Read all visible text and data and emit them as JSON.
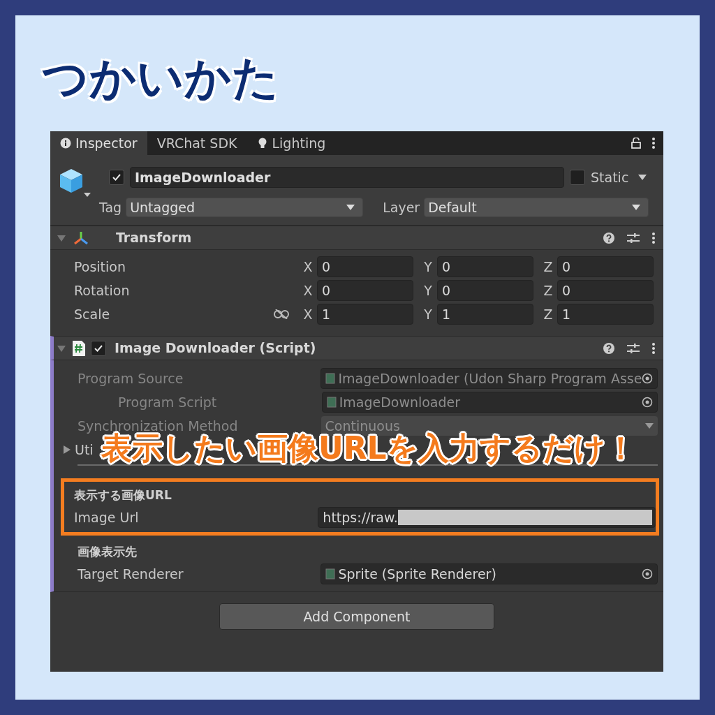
{
  "title": "つかいかた",
  "tabs": [
    {
      "label": "Inspector",
      "selected": true
    },
    {
      "label": "VRChat SDK",
      "selected": false
    },
    {
      "label": "Lighting",
      "selected": false
    }
  ],
  "object": {
    "active": true,
    "name": "ImageDownloader",
    "static": false,
    "static_label": "Static",
    "tag_label": "Tag",
    "tag": "Untagged",
    "layer_label": "Layer",
    "layer": "Default"
  },
  "components": [
    {
      "kind": "transform",
      "title": "Transform",
      "expanded": true,
      "rows": [
        {
          "label": "Position",
          "fields": [
            {
              "axis": "X",
              "value": "0"
            },
            {
              "axis": "Y",
              "value": "0"
            },
            {
              "axis": "Z",
              "value": "0"
            }
          ]
        },
        {
          "label": "Rotation",
          "fields": [
            {
              "axis": "X",
              "value": "0"
            },
            {
              "axis": "Y",
              "value": "0"
            },
            {
              "axis": "Z",
              "value": "0"
            }
          ]
        },
        {
          "label": "Scale",
          "linked": false,
          "fields": [
            {
              "axis": "X",
              "value": "1"
            },
            {
              "axis": "Y",
              "value": "1"
            },
            {
              "axis": "Z",
              "value": "1"
            }
          ]
        }
      ]
    },
    {
      "kind": "script",
      "title": "Image Downloader (Script)",
      "enabled": true,
      "expanded": true,
      "rows": [
        {
          "kind": "object",
          "label": "Program Source",
          "value": "ImageDownloader (Udon Sharp Program Asse",
          "disabled": true,
          "children": [
            {
              "kind": "object",
              "label": "Program Script",
              "value": "ImageDownloader",
              "disabled": true
            }
          ]
        },
        {
          "kind": "dropdown",
          "label": "Synchronization Method",
          "value": "Continuous",
          "disabled": true
        },
        {
          "kind": "foldout",
          "label": "Uti",
          "expanded": false
        },
        {
          "kind": "group",
          "highlighted": true,
          "children": [
            {
              "kind": "header",
              "label": "表示する画像URL"
            },
            {
              "kind": "text",
              "label": "Image Url",
              "value": "https://raw.",
              "redacted": true
            }
          ]
        },
        {
          "kind": "header",
          "label": "画像表示先"
        },
        {
          "kind": "object",
          "label": "Target Renderer",
          "value": "Sprite (Sprite Renderer)",
          "disabled": false
        }
      ]
    }
  ],
  "add_component": "Add Component",
  "callout": "表示したい画像URLを入力するだけ！"
}
